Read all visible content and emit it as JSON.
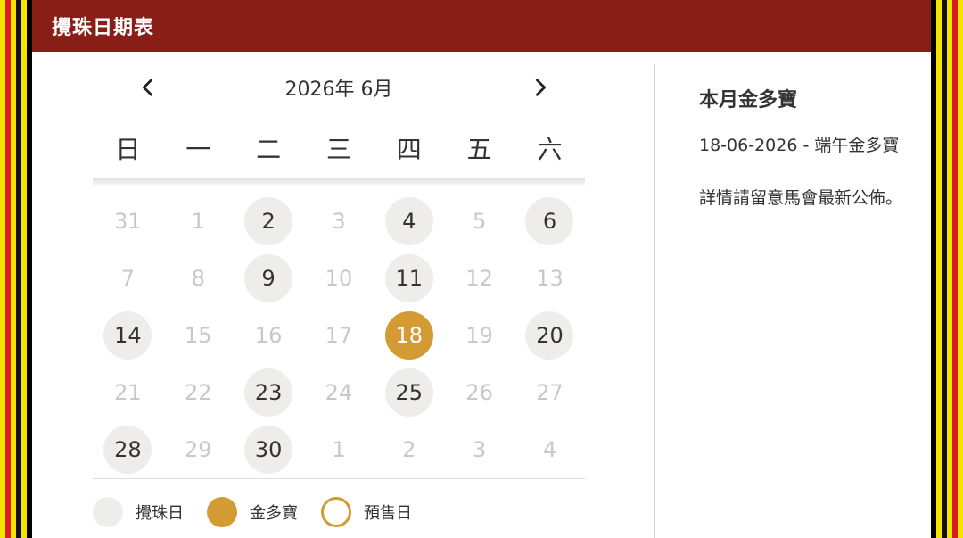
{
  "header": {
    "title": "攪珠日期表"
  },
  "calendar": {
    "month_label": "2026年 6月",
    "weekdays": [
      "日",
      "一",
      "二",
      "三",
      "四",
      "五",
      "六"
    ],
    "weeks": [
      [
        {
          "d": "31",
          "t": "o"
        },
        {
          "d": "1",
          "t": "n"
        },
        {
          "d": "2",
          "t": "draw"
        },
        {
          "d": "3",
          "t": "n"
        },
        {
          "d": "4",
          "t": "draw"
        },
        {
          "d": "5",
          "t": "n"
        },
        {
          "d": "6",
          "t": "draw"
        }
      ],
      [
        {
          "d": "7",
          "t": "n"
        },
        {
          "d": "8",
          "t": "n"
        },
        {
          "d": "9",
          "t": "draw"
        },
        {
          "d": "10",
          "t": "n"
        },
        {
          "d": "11",
          "t": "draw"
        },
        {
          "d": "12",
          "t": "n"
        },
        {
          "d": "13",
          "t": "n"
        }
      ],
      [
        {
          "d": "14",
          "t": "draw"
        },
        {
          "d": "15",
          "t": "n"
        },
        {
          "d": "16",
          "t": "n"
        },
        {
          "d": "17",
          "t": "n"
        },
        {
          "d": "18",
          "t": "jackpot"
        },
        {
          "d": "19",
          "t": "n"
        },
        {
          "d": "20",
          "t": "draw"
        }
      ],
      [
        {
          "d": "21",
          "t": "n"
        },
        {
          "d": "22",
          "t": "n"
        },
        {
          "d": "23",
          "t": "draw"
        },
        {
          "d": "24",
          "t": "n"
        },
        {
          "d": "25",
          "t": "draw"
        },
        {
          "d": "26",
          "t": "n"
        },
        {
          "d": "27",
          "t": "n"
        }
      ],
      [
        {
          "d": "28",
          "t": "draw"
        },
        {
          "d": "29",
          "t": "n"
        },
        {
          "d": "30",
          "t": "draw"
        },
        {
          "d": "1",
          "t": "o"
        },
        {
          "d": "2",
          "t": "o"
        },
        {
          "d": "3",
          "t": "o"
        },
        {
          "d": "4",
          "t": "o"
        }
      ]
    ]
  },
  "legend": {
    "draw_label": "攪珠日",
    "jackpot_label": "金多寶",
    "presale_label": "預售日"
  },
  "side": {
    "title": "本月金多寶",
    "event": "18-06-2026 - 端午金多寶",
    "note": "詳情請留意馬會最新公佈。"
  },
  "colors": {
    "header_bg": "#881e16",
    "jackpot": "#d49a34",
    "draw": "#efedeb"
  }
}
